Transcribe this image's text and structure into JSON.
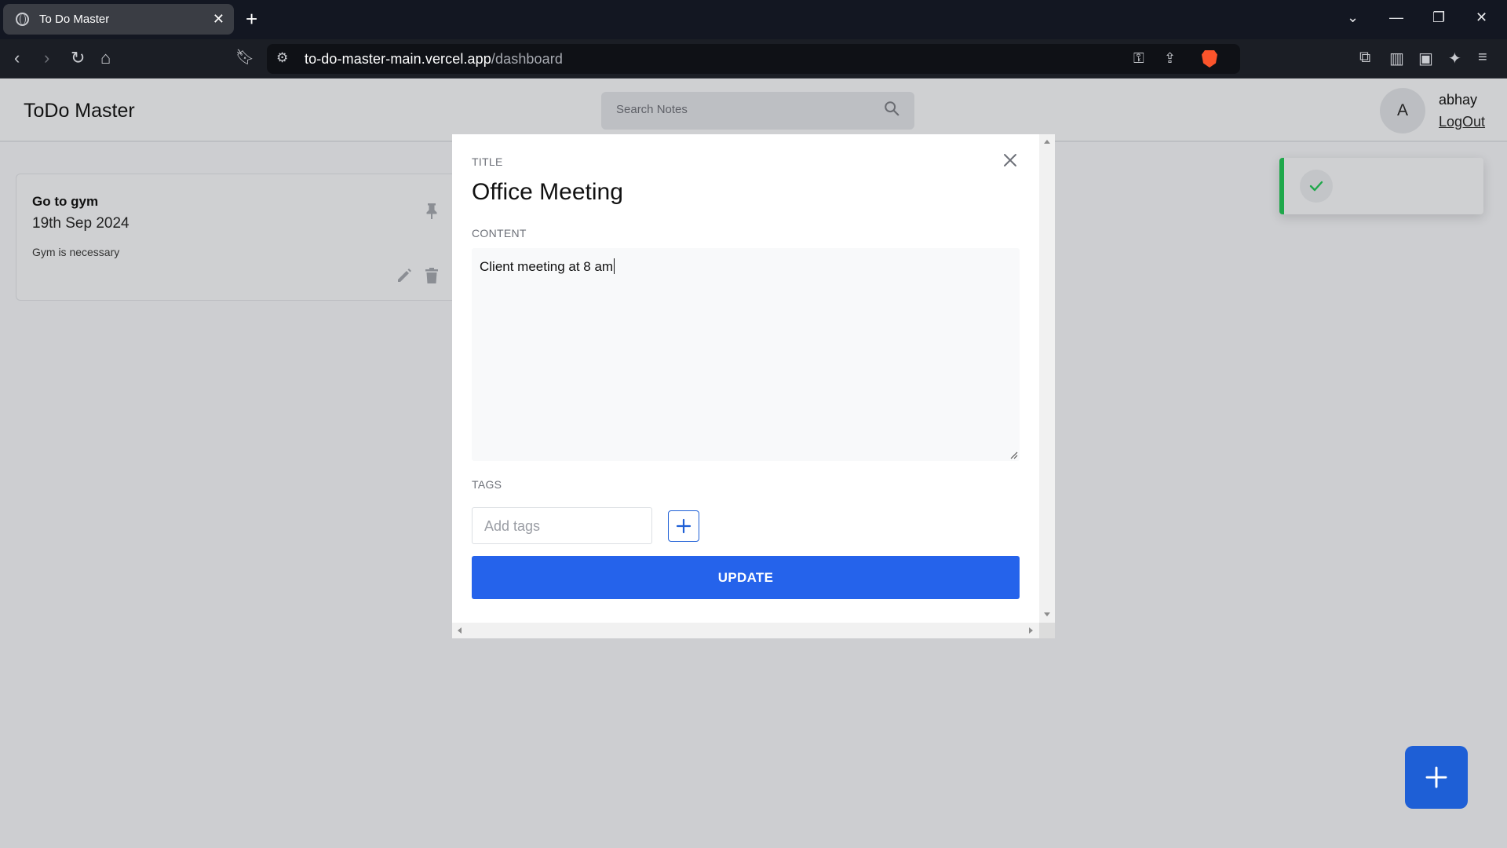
{
  "browser": {
    "tab_title": "To Do Master",
    "url_domain": "to-do-master-main.vercel.app",
    "url_path": "/dashboard"
  },
  "app": {
    "logo": "ToDo Master",
    "search_placeholder": "Search Notes",
    "avatar_initial": "A",
    "user_name": "abhay",
    "logout_label": "LogOut"
  },
  "note": {
    "title": "Go to gym",
    "date": "19th Sep 2024",
    "content": "Gym is necessary"
  },
  "modal": {
    "title_label": "TITLE",
    "title_value": "Office Meeting",
    "content_label": "CONTENT",
    "content_value": "Client meeting at 8 am",
    "tags_label": "TAGS",
    "tags_placeholder": "Add tags",
    "update_label": "UPDATE"
  },
  "colors": {
    "accent": "#2563eb",
    "toast_success": "#1fa84b"
  }
}
